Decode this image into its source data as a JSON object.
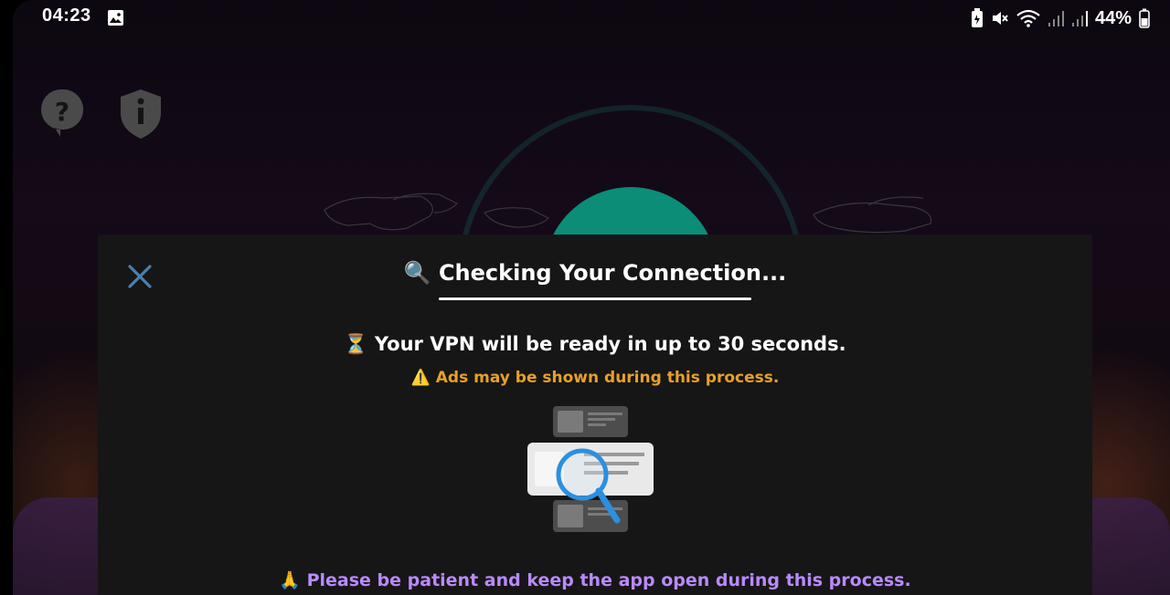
{
  "status_bar": {
    "time": "04:23",
    "battery_percent": "44%",
    "icons": [
      "gallery-icon",
      "battery-saver-icon",
      "mute-icon",
      "wifi-icon",
      "signal-icon",
      "signal-icon",
      "battery-icon"
    ]
  },
  "background_app": {
    "icons": [
      "help-icon",
      "shield-info-icon",
      "world-map",
      "power-button"
    ],
    "accent_color": "#0b8d78"
  },
  "dialog": {
    "title_icon": "🔍",
    "title": "Checking Your Connection...",
    "ready_icon": "⏳",
    "ready_text": "Your VPN will be ready in up to 30 seconds.",
    "ads_icon": "⚠️",
    "ads_text": "Ads may be shown during this process.",
    "illustration": "search-results-illustration",
    "patience_icon": "🙏",
    "patience_text": "Please be patient and keep the app open during this process.",
    "colors": {
      "ads_text": "#e9a026",
      "patience_text": "#b98aff",
      "close_icon": "#4a7fb0",
      "background": "#161616"
    }
  }
}
